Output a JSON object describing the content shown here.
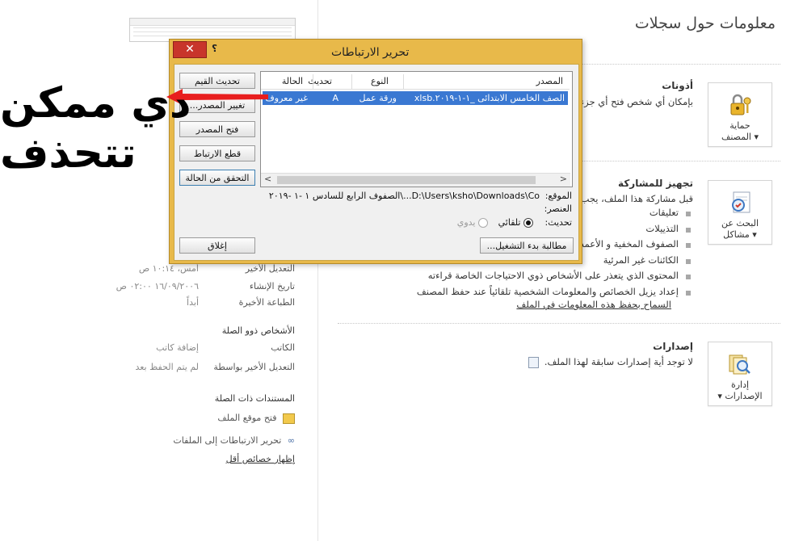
{
  "page": {
    "title": "معلومات حول سجلات"
  },
  "sections": {
    "permissions": {
      "title": "أذونات",
      "text": "بإمكان أي شخص فتح أي جزء",
      "button": {
        "line1": "حماية",
        "line2": "المصنف",
        "icon": "lock-keys-icon"
      }
    },
    "prepare": {
      "title": "تجهيز للمشاركة",
      "text": "قبل مشاركة هذا الملف، يجب",
      "button": {
        "line1": "البحث عن",
        "line2": "مشاكل",
        "icon": "inspect-document-icon"
      },
      "items": [
        "تعليقات",
        "التذييلات",
        "الصفوف المخفية و الأعمدة",
        "الكائنات غير المرئية",
        "المحتوى الذي يتعذر على الأشخاص ذوي الاحتياجات الخاصة قراءته",
        "إعداد يزيل الخصائص والمعلومات الشخصية تلقائياً عند حفظ المصنف"
      ],
      "link": "السماح بحفظ هذه المعلومات في الملف"
    },
    "versions": {
      "title": "إصدارات",
      "text": "لا توجد أية إصدارات سابقة لهذا الملف.",
      "button": {
        "line1": "إدارة",
        "line2": "الإصدارات",
        "icon": "manage-versions-icon"
      }
    }
  },
  "properties": {
    "dates": [
      {
        "label": "التعديل الأخير",
        "value": "أمس، ١٠:١٤ ص"
      },
      {
        "label": "تاريخ الإنشاء",
        "value": "١٦/٠٩/٢٠٠٦ ٠٢:٠٠ ص"
      },
      {
        "label": "الطباعة الأخيرة",
        "value": "أبداً"
      }
    ],
    "people_heading": "الأشخاص ذوو الصلة",
    "people": [
      {
        "label": "الكاتب",
        "value": "إضافة كاتب"
      },
      {
        "label": "التعديل الأخير بواسطة",
        "value": "لم يتم الحفظ بعد"
      }
    ],
    "docs_heading": "المستندات ذات الصلة",
    "docs": [
      {
        "label": "فتح موقع الملف",
        "icon": "folder-open-icon"
      },
      {
        "label": "تحرير الارتباطات إلى الملفات",
        "icon": "link-chain-icon"
      }
    ],
    "fewer_link": "إظهار خصائص أقل"
  },
  "dialog": {
    "title": "تحرير الارتباطات",
    "help": "؟",
    "close": "✕",
    "buttons": {
      "update_values": "تحديث القيم",
      "change_source": "تغيير المصدر...",
      "open_source": "فتح المصدر",
      "break_link": "قطع الارتباط",
      "check_status": "التحقق من الحالة",
      "close": "إغلاق",
      "startup_prompt": "مطالبة بدء التشغيل..."
    },
    "columns": [
      "المصدر",
      "النوع",
      "تحديث",
      "الحالة"
    ],
    "row": {
      "source": "الصف الخامس الابتدائى _١-١-٢٠١٩.xlsb",
      "type": "ورقة عمل",
      "update": "A",
      "status": "غير معروف"
    },
    "location_label": "الموقع:",
    "location_value": "D:\\Users\\ksho\\Downloads\\Co...\\الصفوف الرابع للسادس ١ -١ -٢٠١٩",
    "item_label": "العنصر:",
    "update_label": "تحديث:",
    "auto_label": "تلقائي",
    "manual_label": "يدوي"
  },
  "annotation": {
    "line1": "دي ممكن",
    "line2": "تتحذف",
    "arrow_color": "#e81e1e"
  }
}
